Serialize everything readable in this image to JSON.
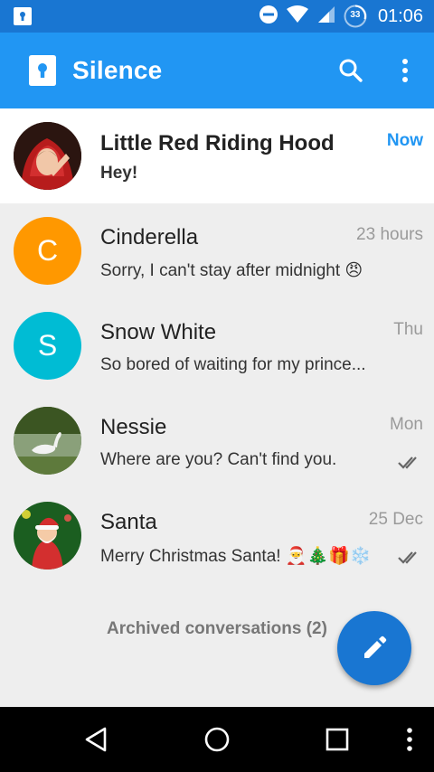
{
  "status_bar": {
    "time": "01:06",
    "battery_level": "33"
  },
  "toolbar": {
    "title": "Silence"
  },
  "conversations": [
    {
      "name": "Little Red Riding Hood",
      "snippet": "Hey!",
      "date": "Now",
      "unread": true,
      "avatar_color": "#8b1a1a"
    },
    {
      "name": "Cinderella",
      "snippet": "Sorry, I can't stay after midnight 😠",
      "date": "23 hours",
      "initial": "C",
      "avatar_color": "#ff9800"
    },
    {
      "name": "Snow White",
      "snippet": "So bored of waiting for my prince...",
      "date": "Thu",
      "initial": "S",
      "avatar_color": "#00bcd4"
    },
    {
      "name": "Nessie",
      "snippet": "Where are you? Can't find you.",
      "date": "Mon",
      "avatar_color": "#5b7d3a"
    },
    {
      "name": "Santa",
      "snippet": "Merry Christmas Santa! 🎅🎄🎁❄️",
      "date": "25 Dec",
      "avatar_color": "#c62828"
    }
  ],
  "archived_label": "Archived conversations (2)",
  "colors": {
    "status_bar": "#1976d2",
    "toolbar": "#2196f3",
    "accent": "#2196f3",
    "fab": "#1976d2"
  }
}
